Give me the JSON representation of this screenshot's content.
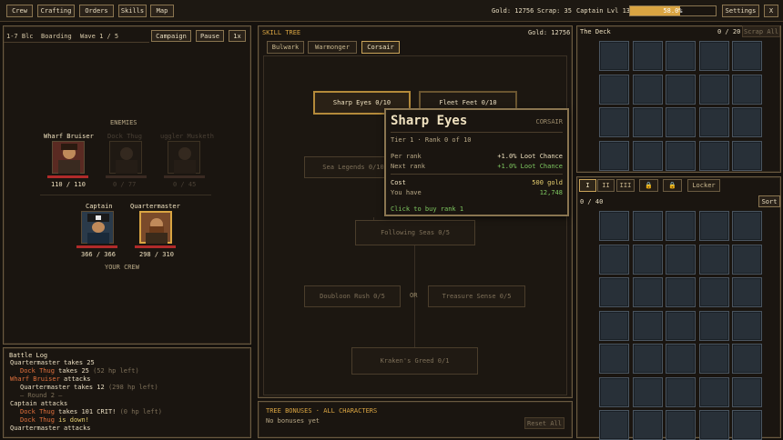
{
  "nav": {
    "items": [
      "Crew",
      "Crafting",
      "Orders",
      "Skills",
      "Map"
    ]
  },
  "header": {
    "gold_label": "Gold: 12756",
    "scrap_label": "Scrap: 35",
    "captain_label": "Captain Lvl 13:",
    "xp_percent": 58,
    "xp_text": "58.0%",
    "settings": "Settings",
    "close": "X"
  },
  "battle": {
    "stage": "1-7 Blc",
    "mode": "Boarding",
    "wave": "Wave 1 / 5",
    "campaign": "Campaign",
    "pause": "Pause",
    "speed": "1x",
    "enemies_label": "ENEMIES",
    "crew_label": "YOUR CREW",
    "enemies": [
      {
        "name": "Wharf Bruiser",
        "hp": "110 / 110",
        "alive": true
      },
      {
        "name": "Dock Thug",
        "hp": "0 / 77",
        "alive": false
      },
      {
        "name": "uggler Musketh",
        "hp": "0 / 45",
        "alive": false
      }
    ],
    "crew": [
      {
        "name": "Captain",
        "hp": "366 / 366"
      },
      {
        "name": "Quartermaster",
        "hp": "298 / 310"
      }
    ]
  },
  "log": {
    "title": "Battle Log",
    "lines": [
      {
        "text": "Quartermaster takes 25",
        "color": "#e8dcc0"
      },
      {
        "text": "Dock Thug",
        "extra": " takes 25",
        "hint": "(52 hp left)",
        "color": "#e0703c",
        "indent": true
      },
      {
        "text": "Wharf Bruiser",
        "extra": " attacks",
        "color": "#e0703c"
      },
      {
        "text": "Quartermaster",
        "extra": " takes 12",
        "hint": "(298 hp left)",
        "color": "#e8dcc0",
        "indent": true
      },
      {
        "text": "— Round 2 —",
        "color": "#7e7059",
        "indent": true
      },
      {
        "text": "Captain",
        "extra": " attacks",
        "color": "#e8dcc0"
      },
      {
        "text": "Dock Thug",
        "extra": " takes 101 CRIT!",
        "hint": "(0 hp left)",
        "color": "#e0703c",
        "indent": true
      },
      {
        "text": "Dock Thug",
        "extra": " is down!",
        "color": "#e0703c",
        "extraColor": "#e8d070",
        "indent": true
      },
      {
        "text": "Quartermaster attacks",
        "color": "#e8dcc0"
      }
    ]
  },
  "skill_tree": {
    "title": "SKILL TREE",
    "gold": "Gold: 12756",
    "tabs": [
      "Bulwark",
      "Warmonger",
      "Corsair"
    ],
    "active_tab": 2,
    "nodes": {
      "sharp_eyes": "Sharp Eyes 0/10",
      "fleet_feet": "Fleet Feet 0/10",
      "sea_legends": "Sea Legends 0/10",
      "following_seas": "Following Seas 0/5",
      "doubloon_rush": "Doubloon Rush 0/5",
      "or_label": "OR",
      "treasure_sense": "Treasure Sense 0/5",
      "krakens_greed": "Kraken's Greed 0/1"
    },
    "bonuses_title": "TREE BONUSES · ALL CHARACTERS",
    "bonuses_text": "No bonuses yet",
    "reset": "Reset All"
  },
  "tooltip": {
    "title": "Sharp Eyes",
    "tag": "CORSAIR",
    "sub": "Tier 1 · Rank 0 of 10",
    "per_rank_label": "Per rank",
    "per_rank_value": "+1.0% Loot Chance",
    "next_rank_label": "Next rank",
    "next_rank_value": "+1.0% Loot Chance",
    "cost_label": "Cost",
    "cost_value": "500 gold",
    "have_label": "You have",
    "have_value": "12,748",
    "cta": "Click to buy rank 1"
  },
  "deck": {
    "title": "The Deck",
    "count": "0 / 20",
    "scrap_all": "Scrap All"
  },
  "locker": {
    "tabs": [
      "I",
      "II",
      "III"
    ],
    "locker_label": "Locker",
    "count": "0 / 40",
    "sort": "Sort"
  }
}
